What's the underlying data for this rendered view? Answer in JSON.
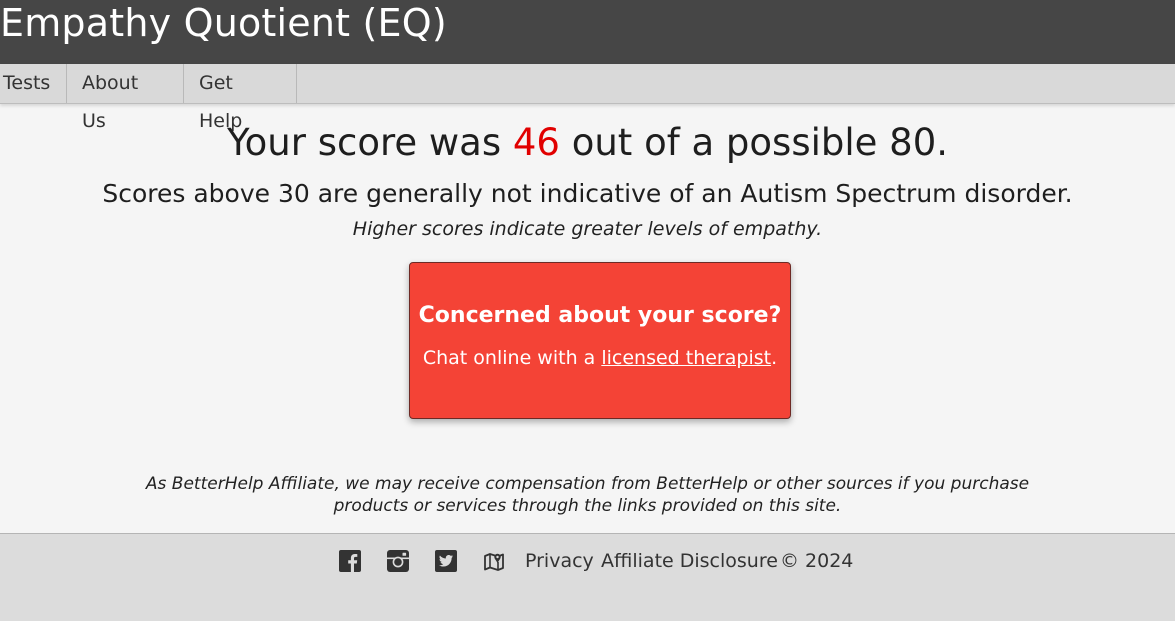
{
  "header": {
    "title": "Empathy Quotient (EQ)"
  },
  "nav": {
    "items": [
      {
        "label": "Tests"
      },
      {
        "label": "About Us"
      },
      {
        "label": "Get Help"
      }
    ]
  },
  "result": {
    "score_prefix": "Your score was ",
    "score_value": "46",
    "score_suffix": " out of a possible 80.",
    "interpretation": "Scores above 30 are generally not indicative of an Autism Spectrum disorder.",
    "note": "Higher scores indicate greater levels of empathy.",
    "score_color": "#e10000"
  },
  "promo": {
    "heading": "Concerned about your score?",
    "text_prefix": "Chat online with a ",
    "link_text": "licensed therapist",
    "text_suffix": ".",
    "background": "#f44336"
  },
  "disclaimer": {
    "line1": "As BetterHelp Affiliate, we may receive compensation from BetterHelp or other sources if you purchase",
    "line2": "products or services through the links provided on this site."
  },
  "footer": {
    "icons": [
      "facebook-icon",
      "instagram-icon",
      "twitter-icon",
      "map-icon"
    ],
    "privacy": "Privacy",
    "affiliate": "Affiliate Disclosure",
    "copyright": "© 2024"
  }
}
